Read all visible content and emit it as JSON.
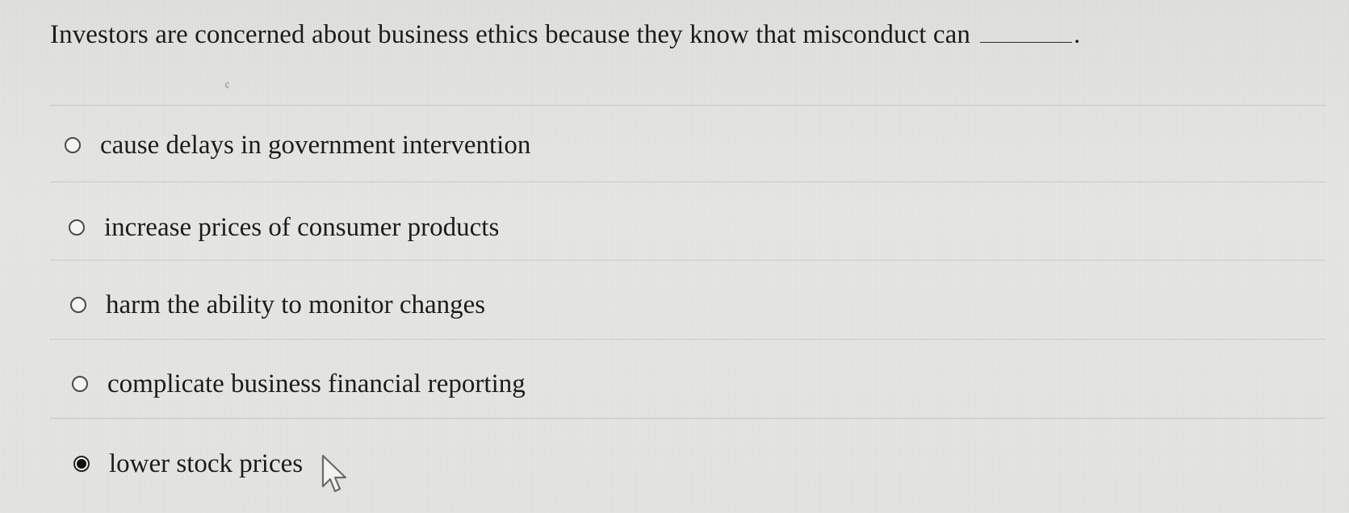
{
  "question": {
    "text": "Investors are concerned about business ethics because they know that misconduct can",
    "period": "."
  },
  "options": [
    {
      "label": "cause delays in government intervention",
      "selected": false
    },
    {
      "label": "increase prices of consumer products",
      "selected": false
    },
    {
      "label": "harm the ability to monitor changes",
      "selected": false
    },
    {
      "label": "complicate business financial reporting",
      "selected": false
    },
    {
      "label": "lower stock prices",
      "selected": true
    }
  ],
  "colors": {
    "background": "#e4e5e1",
    "text": "#1c1c1c",
    "divider": "#c7c8c4"
  }
}
